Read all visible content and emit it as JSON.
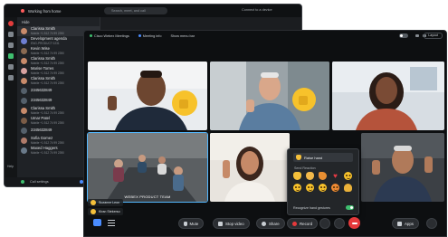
{
  "back_window": {
    "status_text": "Working from home",
    "search_placeholder": "Search, meet, and call",
    "connect_text": "Connect to a device",
    "list_header": "Hide",
    "help_label": "Help",
    "contacts": [
      {
        "name": "Clarissa Smith",
        "sub": "Mobile +1 512 74 99 2390",
        "color": "#c98b6b"
      },
      {
        "name": "Development agenda",
        "sub": "ENG-PRODUCT 0231",
        "color": "#6e7fd1"
      },
      {
        "name": "Kevin Wise",
        "sub": "Mobile +1 512 74 99 2390",
        "color": "#8a6a52"
      },
      {
        "name": "Clarissa Smith",
        "sub": "Mobile +1 512 74 99 2390",
        "color": "#c98b6b"
      },
      {
        "name": "Marise Torres",
        "sub": "Mobile +1 512 74 99 2390",
        "color": "#d9a2a0"
      },
      {
        "name": "Clarissa Smith",
        "sub": "Mobile +1 512 74 99 2390",
        "color": "#c98b6b"
      },
      {
        "name": "2345632849",
        "sub": "",
        "color": "#55606b"
      },
      {
        "name": "2345632849",
        "sub": "",
        "color": "#55606b"
      },
      {
        "name": "Clarissa Smith",
        "sub": "Mobile +1 512 74 99 2390",
        "color": "#c98b6b"
      },
      {
        "name": "Umar Patel",
        "sub": "Mobile +1 512 74 99 2390",
        "color": "#7b5c47"
      },
      {
        "name": "2345632849",
        "sub": "",
        "color": "#55606b"
      },
      {
        "name": "Sofia Gomez",
        "sub": "Mobile +1 512 74 99 2390",
        "color": "#b07c6b"
      },
      {
        "name": "Maxed Haggers",
        "sub": "Mobile +1 512 74 99 2390",
        "color": "#6a7a8a"
      }
    ],
    "footer": {
      "call_settings": "Call settings",
      "device": "Barbara German"
    }
  },
  "meeting": {
    "titlebar": {
      "app": "Cisco Webex Meetings",
      "info": "Meeting info",
      "hide_bar": "Show menu bar"
    },
    "layout_label": "Layout",
    "tiles": [
      {
        "name": "thumbs-up man"
      },
      {
        "name": "older man thumbs up"
      },
      {
        "name": "smiling woman"
      },
      {
        "name": "conference room",
        "label": "WEBEX PRODUCT TEAM"
      },
      {
        "name": "woman waving"
      },
      {
        "name": "man waving"
      }
    ],
    "reaction_popover": {
      "raise_hand": "Raise hand",
      "send_reaction_title": "Send Reaction",
      "gestures_label": "Recognize hand gestures",
      "reactions": [
        "thumbs-up",
        "clap",
        "party",
        "heart",
        "smile",
        "wow",
        "laugh",
        "sad",
        "angry",
        "thumbs-down"
      ]
    },
    "reaction_feed": [
      {
        "name": "Suzanne Leon"
      },
      {
        "name": "Kiran Stekerso"
      }
    ],
    "controls": {
      "mute": "Mute",
      "stop_video": "Stop video",
      "share": "Share",
      "record": "Record",
      "apps": "Apps"
    }
  }
}
